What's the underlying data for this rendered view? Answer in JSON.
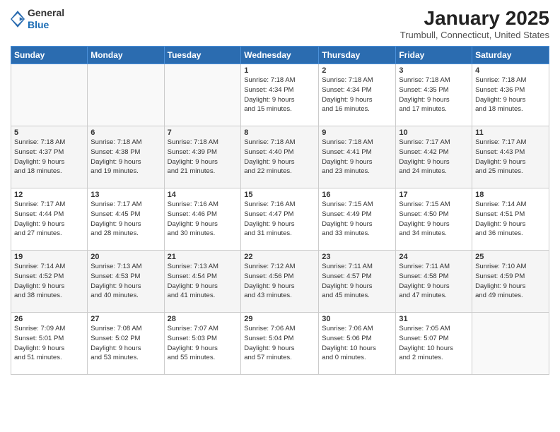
{
  "header": {
    "logo_line1": "General",
    "logo_line2": "Blue",
    "month": "January 2025",
    "location": "Trumbull, Connecticut, United States"
  },
  "days_of_week": [
    "Sunday",
    "Monday",
    "Tuesday",
    "Wednesday",
    "Thursday",
    "Friday",
    "Saturday"
  ],
  "weeks": [
    [
      {
        "day": "",
        "info": ""
      },
      {
        "day": "",
        "info": ""
      },
      {
        "day": "",
        "info": ""
      },
      {
        "day": "1",
        "info": "Sunrise: 7:18 AM\nSunset: 4:34 PM\nDaylight: 9 hours\nand 15 minutes."
      },
      {
        "day": "2",
        "info": "Sunrise: 7:18 AM\nSunset: 4:34 PM\nDaylight: 9 hours\nand 16 minutes."
      },
      {
        "day": "3",
        "info": "Sunrise: 7:18 AM\nSunset: 4:35 PM\nDaylight: 9 hours\nand 17 minutes."
      },
      {
        "day": "4",
        "info": "Sunrise: 7:18 AM\nSunset: 4:36 PM\nDaylight: 9 hours\nand 18 minutes."
      }
    ],
    [
      {
        "day": "5",
        "info": "Sunrise: 7:18 AM\nSunset: 4:37 PM\nDaylight: 9 hours\nand 18 minutes."
      },
      {
        "day": "6",
        "info": "Sunrise: 7:18 AM\nSunset: 4:38 PM\nDaylight: 9 hours\nand 19 minutes."
      },
      {
        "day": "7",
        "info": "Sunrise: 7:18 AM\nSunset: 4:39 PM\nDaylight: 9 hours\nand 21 minutes."
      },
      {
        "day": "8",
        "info": "Sunrise: 7:18 AM\nSunset: 4:40 PM\nDaylight: 9 hours\nand 22 minutes."
      },
      {
        "day": "9",
        "info": "Sunrise: 7:18 AM\nSunset: 4:41 PM\nDaylight: 9 hours\nand 23 minutes."
      },
      {
        "day": "10",
        "info": "Sunrise: 7:17 AM\nSunset: 4:42 PM\nDaylight: 9 hours\nand 24 minutes."
      },
      {
        "day": "11",
        "info": "Sunrise: 7:17 AM\nSunset: 4:43 PM\nDaylight: 9 hours\nand 25 minutes."
      }
    ],
    [
      {
        "day": "12",
        "info": "Sunrise: 7:17 AM\nSunset: 4:44 PM\nDaylight: 9 hours\nand 27 minutes."
      },
      {
        "day": "13",
        "info": "Sunrise: 7:17 AM\nSunset: 4:45 PM\nDaylight: 9 hours\nand 28 minutes."
      },
      {
        "day": "14",
        "info": "Sunrise: 7:16 AM\nSunset: 4:46 PM\nDaylight: 9 hours\nand 30 minutes."
      },
      {
        "day": "15",
        "info": "Sunrise: 7:16 AM\nSunset: 4:47 PM\nDaylight: 9 hours\nand 31 minutes."
      },
      {
        "day": "16",
        "info": "Sunrise: 7:15 AM\nSunset: 4:49 PM\nDaylight: 9 hours\nand 33 minutes."
      },
      {
        "day": "17",
        "info": "Sunrise: 7:15 AM\nSunset: 4:50 PM\nDaylight: 9 hours\nand 34 minutes."
      },
      {
        "day": "18",
        "info": "Sunrise: 7:14 AM\nSunset: 4:51 PM\nDaylight: 9 hours\nand 36 minutes."
      }
    ],
    [
      {
        "day": "19",
        "info": "Sunrise: 7:14 AM\nSunset: 4:52 PM\nDaylight: 9 hours\nand 38 minutes."
      },
      {
        "day": "20",
        "info": "Sunrise: 7:13 AM\nSunset: 4:53 PM\nDaylight: 9 hours\nand 40 minutes."
      },
      {
        "day": "21",
        "info": "Sunrise: 7:13 AM\nSunset: 4:54 PM\nDaylight: 9 hours\nand 41 minutes."
      },
      {
        "day": "22",
        "info": "Sunrise: 7:12 AM\nSunset: 4:56 PM\nDaylight: 9 hours\nand 43 minutes."
      },
      {
        "day": "23",
        "info": "Sunrise: 7:11 AM\nSunset: 4:57 PM\nDaylight: 9 hours\nand 45 minutes."
      },
      {
        "day": "24",
        "info": "Sunrise: 7:11 AM\nSunset: 4:58 PM\nDaylight: 9 hours\nand 47 minutes."
      },
      {
        "day": "25",
        "info": "Sunrise: 7:10 AM\nSunset: 4:59 PM\nDaylight: 9 hours\nand 49 minutes."
      }
    ],
    [
      {
        "day": "26",
        "info": "Sunrise: 7:09 AM\nSunset: 5:01 PM\nDaylight: 9 hours\nand 51 minutes."
      },
      {
        "day": "27",
        "info": "Sunrise: 7:08 AM\nSunset: 5:02 PM\nDaylight: 9 hours\nand 53 minutes."
      },
      {
        "day": "28",
        "info": "Sunrise: 7:07 AM\nSunset: 5:03 PM\nDaylight: 9 hours\nand 55 minutes."
      },
      {
        "day": "29",
        "info": "Sunrise: 7:06 AM\nSunset: 5:04 PM\nDaylight: 9 hours\nand 57 minutes."
      },
      {
        "day": "30",
        "info": "Sunrise: 7:06 AM\nSunset: 5:06 PM\nDaylight: 10 hours\nand 0 minutes."
      },
      {
        "day": "31",
        "info": "Sunrise: 7:05 AM\nSunset: 5:07 PM\nDaylight: 10 hours\nand 2 minutes."
      },
      {
        "day": "",
        "info": ""
      }
    ]
  ]
}
